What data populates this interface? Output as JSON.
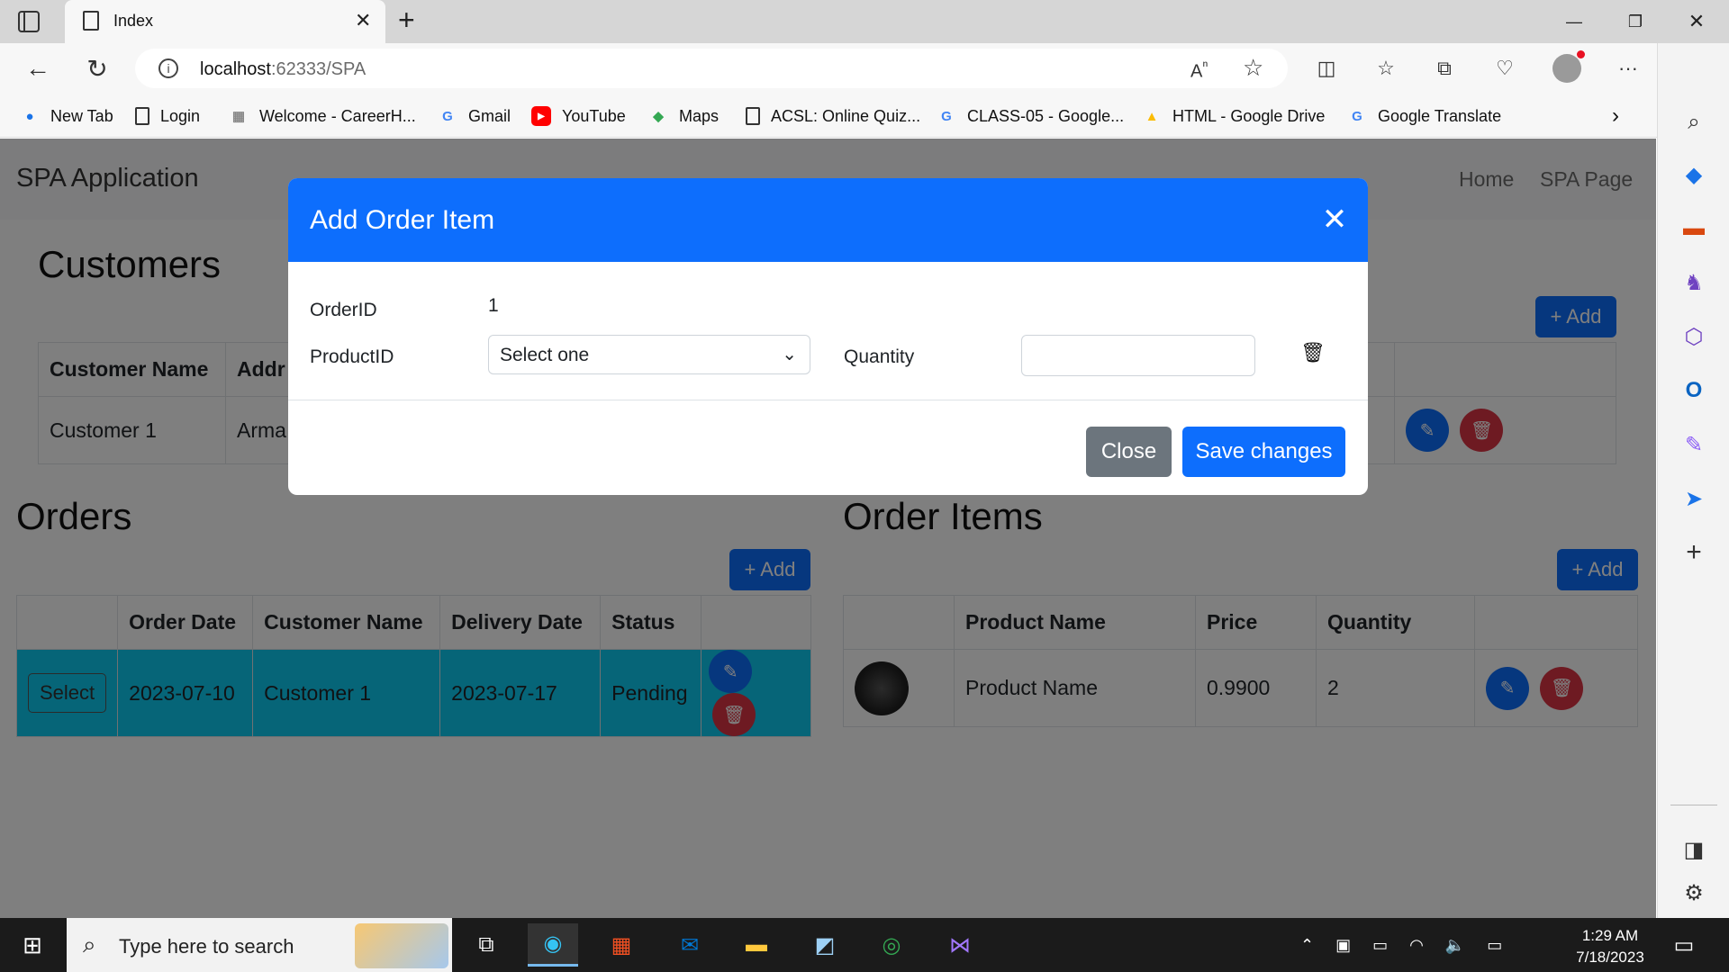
{
  "browser": {
    "tab_title": "Index",
    "url_host": "localhost",
    "url_rest": ":62333/SPA",
    "bookmarks": [
      {
        "label": "New Tab",
        "icon": "edge-icon"
      },
      {
        "label": "Login",
        "icon": "page-icon"
      },
      {
        "label": "Welcome - CareerH...",
        "icon": "site-icon"
      },
      {
        "label": "Gmail",
        "icon": "google-icon"
      },
      {
        "label": "YouTube",
        "icon": "youtube-icon"
      },
      {
        "label": "Maps",
        "icon": "maps-icon"
      },
      {
        "label": "ACSL: Online Quiz...",
        "icon": "page-icon"
      },
      {
        "label": "CLASS-05 - Google...",
        "icon": "google-icon"
      },
      {
        "label": "HTML - Google Drive",
        "icon": "drive-icon"
      },
      {
        "label": "Google Translate",
        "icon": "translate-icon"
      }
    ]
  },
  "app": {
    "brand": "SPA Application",
    "nav": [
      "Home",
      "SPA Page"
    ],
    "customers": {
      "title": "Customers",
      "add_label": "+ Add",
      "headers": [
        "Customer Name",
        "Addr"
      ],
      "rows": [
        [
          "Customer 1",
          "Arma"
        ]
      ]
    },
    "orders": {
      "title": "Orders",
      "add_label": "+ Add",
      "headers": [
        "",
        "Order Date",
        "Customer Name",
        "Delivery Date",
        "Status",
        ""
      ],
      "select_label": "Select",
      "rows": [
        [
          "2023-07-10",
          "Customer 1",
          "2023-07-17",
          "Pending"
        ]
      ]
    },
    "order_items": {
      "title": "Order Items",
      "add_label": "+ Add",
      "headers": [
        "",
        "Product Name",
        "Price",
        "Quantity",
        ""
      ],
      "rows": [
        [
          "Product Name",
          "0.9900",
          "2"
        ]
      ]
    }
  },
  "modal": {
    "title": "Add Order Item",
    "order_id_label": "OrderID",
    "order_id_value": "1",
    "product_id_label": "ProductID",
    "product_select_value": "Select one",
    "quantity_label": "Quantity",
    "quantity_value": "",
    "close_label": "Close",
    "save_label": "Save changes"
  },
  "taskbar": {
    "search_placeholder": "Type here to search",
    "time": "1:29 AM",
    "date": "7/18/2023"
  },
  "colors": {
    "primary": "#0d6efd",
    "danger": "#dc3545",
    "selected_row": "#0dcaf0",
    "secondary": "#6c757d"
  }
}
